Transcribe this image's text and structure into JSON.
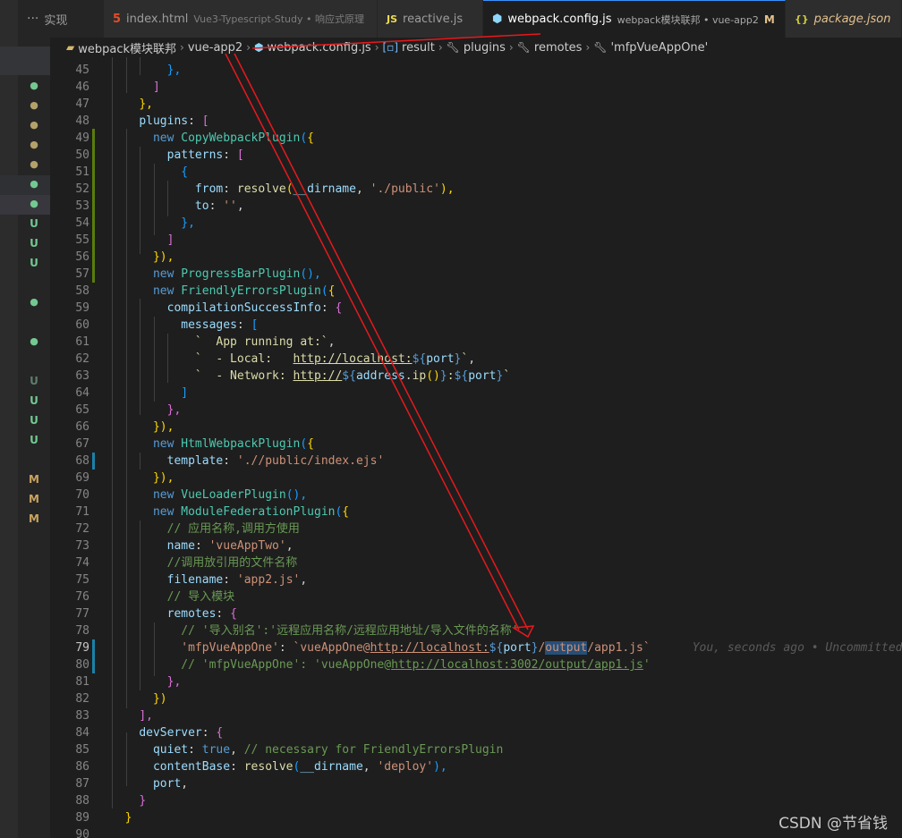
{
  "tabs": [
    {
      "label": "实现",
      "icon": "",
      "desc": ""
    },
    {
      "label": "index.html",
      "icon": "html5-icon",
      "desc": "Vue3-Typescript-Study • 响应式原理"
    },
    {
      "label": "reactive.js",
      "icon": "js-icon",
      "desc": ""
    },
    {
      "label": "webpack.config.js",
      "icon": "webpack-icon",
      "desc": "webpack模块联邦 • vue-app2",
      "modified": "M",
      "active": true
    },
    {
      "label": "package.json",
      "icon": "json-icon",
      "desc": "",
      "modified": "M"
    }
  ],
  "tab_icons": {
    "html": "5",
    "js": "JS",
    "webpack": "⬢",
    "json": "{}",
    "close": "✕",
    "ellipsis": "···"
  },
  "breadcrumb": [
    "webpack模块联邦",
    "vue-app2",
    "webpack.config.js",
    "result",
    "plugins",
    "remotes",
    "'mfpVueAppOne'"
  ],
  "status_marks": [
    "●",
    "●",
    "●",
    "●",
    "●",
    "●",
    "●",
    "U",
    "U",
    "U",
    "●",
    "●",
    "U",
    "U",
    "U",
    "U",
    "M",
    "M",
    "M"
  ],
  "code": {
    "line_numbers": [
      "45",
      "46",
      "47",
      "48",
      "49",
      "50",
      "51",
      "52",
      "53",
      "54",
      "55",
      "56",
      "57",
      "58",
      "59",
      "60",
      "61",
      "62",
      "63",
      "64",
      "65",
      "66",
      "67",
      "68",
      "69",
      "70",
      "71",
      "72",
      "73",
      "74",
      "75",
      "76",
      "77",
      "78",
      "79",
      "80",
      "81",
      "82",
      "83",
      "84",
      "85",
      "86",
      "87",
      "88",
      "89",
      "90"
    ],
    "t": {
      "l45": "},",
      "l46": "]",
      "l47": "},",
      "l48a": "plugins",
      "l48b": ": ",
      "l48c": "[",
      "new": "new ",
      "copy": "CopyWebpackPlugin",
      "po": "(",
      "cbo": "{",
      "patterns": "patterns",
      "colon": ": ",
      "sbo": "[",
      "lb": "{",
      "from": "from",
      "resolve": "resolve",
      "dirname": "__dirname",
      "comma": ", ",
      "public": "'./public'",
      "pc": "),",
      "to": "to",
      "empty": "''",
      "c": ",",
      "rbc": "},",
      "rsb": "]",
      "l56": "}),",
      "progress": "ProgressBarPlugin",
      "pcall": "(),",
      "friendly": "FriendlyErrorsPlugin",
      "csi": "compilationSuccessInfo",
      "messages": "messages",
      "m1": "`  App running at:`",
      "m2a": "`  - Local:   ",
      "m2b": "http://localhost:",
      "m2c": "${",
      "m2d": "port",
      "m2e": "}",
      "m2f": "`",
      "m3a": "`  - Network: ",
      "m3b": "http://",
      "m3c": "${",
      "m3d": "address",
      "m3e": ".",
      "m3f": "ip",
      "m3g": "()",
      "m3h": "}",
      "m3i": ":",
      "m3j": "${",
      "m3k": "port",
      "m3l": "}",
      "m3m": "`",
      "l64": "]",
      "l65": "},",
      "l66": "}),",
      "htmlwp": "HtmlWebpackPlugin",
      "template": "template",
      "tplval": "'.//public/index.ejs'",
      "l69": "}),",
      "vueloader": "VueLoaderPlugin",
      "mfp": "ModuleFederationPlugin",
      "cm72": "// 应用名称,调用方使用",
      "name": "name",
      "nameval": "'vueAppTwo'",
      "cm74": "//调用放引用的文件名称",
      "filename": "filename",
      "fileval": "'app2.js'",
      "cm76": "// 导入模块",
      "remotes": "remotes",
      "cm78": "// '导入别名':'远程应用名称/远程应用地址/导入文件的名称'",
      "key79": "'mfpVueAppOne'",
      "v79a": "`vueAppOne@",
      "v79b": "http://localhost:",
      "v79c": "${",
      "v79d": "port",
      "v79e": "}",
      "v79f": "/",
      "v79g": "output",
      "v79h": "/app1.js",
      "v79i": "`",
      "blame79": "You, seconds ago • Uncommitted changes",
      "cm80a": "// 'mfpVueAppOne': 'vueAppOne@",
      "cm80b": "http://localhost:3002/output/app1.js",
      "cm80c": "'",
      "l81": "},",
      "l82": "})",
      "l83": "],",
      "devserver": "devServer",
      "quiet": "quiet",
      "true": "true",
      "cm85": "// necessary for FriendlyErrorsPlugin",
      "contentbase": "contentBase",
      "deploy": "'deploy'",
      "port": "port",
      "l88": "}",
      "l89": "}"
    }
  },
  "watermark": "CSDN @节省钱",
  "colors": {
    "annotation_arrow": "#e8191d",
    "accent": "#3794ff"
  }
}
